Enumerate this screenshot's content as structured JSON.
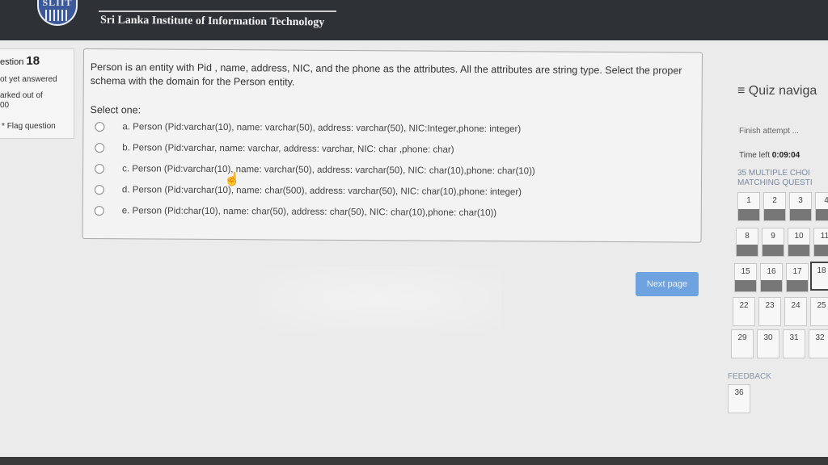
{
  "header": {
    "logo_text": "SLIIT",
    "institute_name": "Sri Lanka Institute of Information Technology"
  },
  "question_info": {
    "label": "estion",
    "number": "18",
    "status": "ot yet answered",
    "marked_out_of": "arked out of",
    "marked_value": "00",
    "flag": "Flag question"
  },
  "question": {
    "text": "Person is an entity with Pid , name, address, NIC, and the phone as the attributes. All the attributes are string type. Select the proper schema with the domain for the Person entity.",
    "select_label": "Select one:",
    "options": [
      "a. Person (Pid:varchar(10), name: varchar(50), address: varchar(50), NIC:Integer,phone: integer)",
      "b. Person (Pid:varchar, name: varchar, address: varchar, NIC: char ,phone: char)",
      "c. Person (Pid:varchar(10), name: varchar(50), address: varchar(50), NIC: char(10),phone: char(10))",
      "d. Person (Pid:varchar(10), name: char(500), address: varchar(50), NIC: char(10),phone: integer)",
      "e. Person (Pid:char(10), name: char(50), address: char(50), NIC: char(10),phone: char(10))"
    ]
  },
  "next_button": "Next page",
  "quiz_nav": {
    "title": "≡ Quiz naviga",
    "finish": "Finish attempt ...",
    "time_label": "Time left",
    "time_value": "0:09:04",
    "section_line1": "35 MULTIPLE CHOI",
    "section_line2": "MATCHING QUESTI",
    "row1": [
      "1",
      "2",
      "3",
      "4"
    ],
    "row2": [
      "8",
      "9",
      "10",
      "11"
    ],
    "row3": [
      "15",
      "16",
      "17",
      "18"
    ],
    "row4": [
      "22",
      "23",
      "24",
      "25"
    ],
    "row5": [
      "29",
      "30",
      "31",
      "32"
    ],
    "feedback": "FEEDBACK",
    "feedback_item": "36"
  }
}
